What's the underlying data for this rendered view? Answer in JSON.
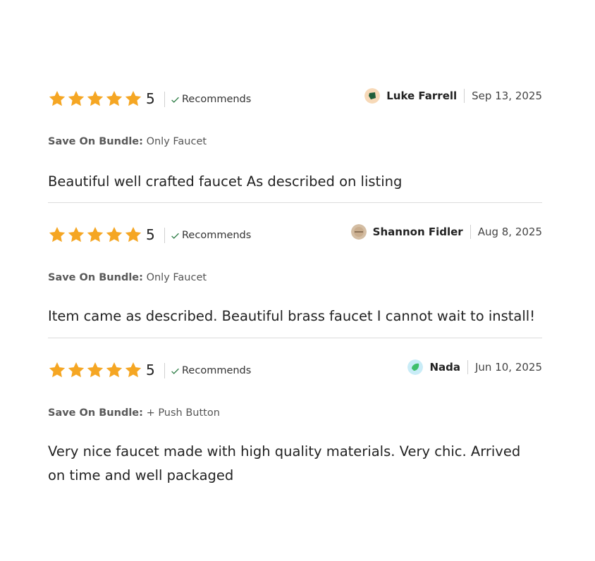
{
  "reviews": [
    {
      "rating": "5",
      "stars_filled": 5,
      "recommends_label": "Recommends",
      "reviewer": "Luke Farrell",
      "date": "Sep 13, 2025",
      "avatar_color": "#1f5e3a",
      "avatar_bg": "#f7d9b8",
      "bundle_label": "Save On Bundle:",
      "bundle_value": "Only Faucet",
      "text": "Beautiful well crafted faucet As described on listing"
    },
    {
      "rating": "5",
      "stars_filled": 5,
      "recommends_label": "Recommends",
      "reviewer": "Shannon Fidler",
      "date": "Aug 8, 2025",
      "avatar_color": "#a8886a",
      "avatar_bg": "#d4bea4",
      "bundle_label": "Save On Bundle:",
      "bundle_value": "Only Faucet",
      "text": "Item came as described. Beautiful brass faucet I cannot wait to install!"
    },
    {
      "rating": "5",
      "stars_filled": 5,
      "recommends_label": "Recommends",
      "reviewer": "Nada",
      "date": "Jun 10, 2025",
      "avatar_color": "#3fbf6b",
      "avatar_bg": "#c9ecf7",
      "bundle_label": "Save On Bundle:",
      "bundle_value": "+ Push Button",
      "text": "Very nice faucet made with high quality materials. Very chic. Arrived on time and well packaged"
    }
  ],
  "colors": {
    "star": "#f5a623",
    "check": "#2e7d46",
    "divider": "#dcdcdc"
  }
}
